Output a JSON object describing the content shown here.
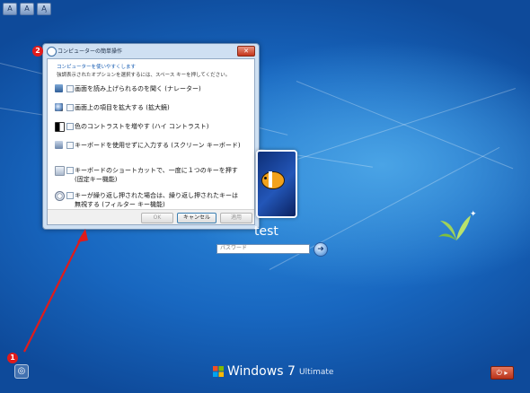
{
  "top_bar": {
    "icons": [
      "A",
      "A",
      "A̧"
    ]
  },
  "dialog": {
    "title": "コンピューターの簡単操作",
    "close_label": "✕",
    "intro_primary": "コンピューターを使いやすくします",
    "intro_secondary": "強調表示されたオプションを選択するには、スペース キーを押してください。",
    "options": [
      {
        "label": "画面を読み上げられるのを聞く (ナレーター)",
        "label2": "",
        "icon": "narrator-icon",
        "checked": false
      },
      {
        "label": "画面上の項目を拡大する (拡大鏡)",
        "label2": "",
        "icon": "magnifier-icon",
        "checked": false
      },
      {
        "label": "色のコントラストを増やす (ハイ コントラスト)",
        "label2": "",
        "icon": "high-contrast-icon",
        "checked": false
      },
      {
        "label": "キーボードを使用せずに入力する (スクリーン キーボード)",
        "label2": "",
        "icon": "on-screen-keyboard-icon",
        "checked": false
      },
      {
        "label": "キーボードのショートカットで、一度に１つのキーを押す",
        "label2": "(固定キー機能)",
        "icon": "sticky-keys-icon",
        "checked": false
      },
      {
        "label": "キーが繰り返し押された場合は、繰り返し押されたキーは",
        "label2": "無視する (フィルター キー機能)",
        "icon": "filter-keys-icon",
        "checked": false
      }
    ],
    "buttons": {
      "ok": "OK",
      "cancel": "キャンセル",
      "apply": "適用"
    }
  },
  "user": {
    "name": "test"
  },
  "password": {
    "placeholder": "パスワード"
  },
  "brand": {
    "word": "Windows 7",
    "edition": "Ultimate"
  },
  "markers": {
    "one": "1",
    "two": "2"
  },
  "colors": {
    "arrow": "#e01b1b",
    "accent": "#1a5fb4"
  }
}
